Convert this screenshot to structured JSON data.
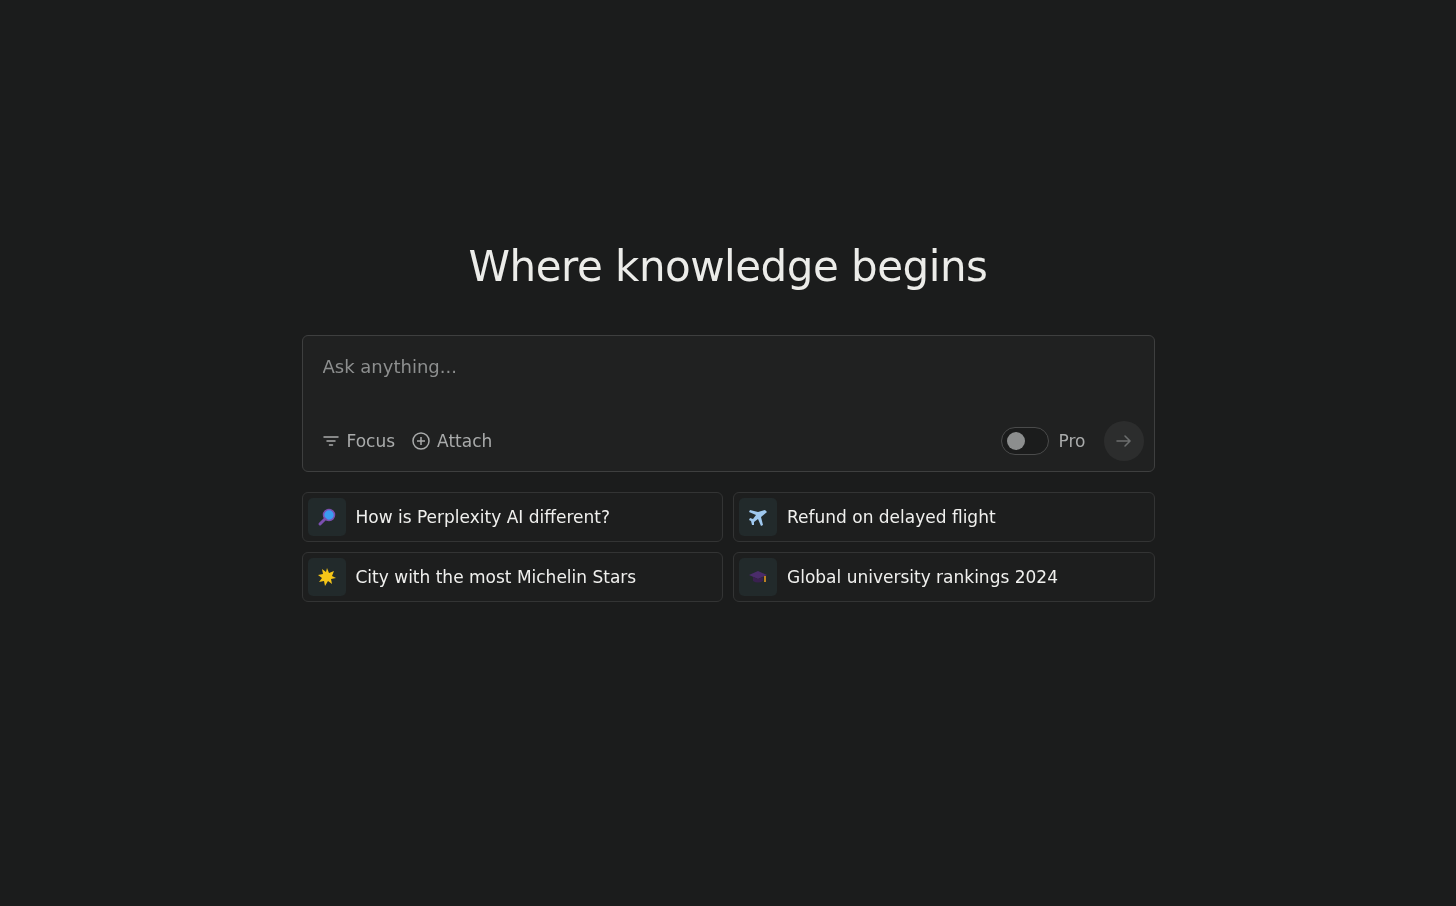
{
  "heading": "Where knowledge begins",
  "search": {
    "placeholder": "Ask anything...",
    "focus_label": "Focus",
    "attach_label": "Attach",
    "pro": {
      "label": "Pro",
      "on": false
    }
  },
  "suggestions": [
    {
      "kind": "magnifier",
      "text": "How is Perplexity AI different?"
    },
    {
      "kind": "airplane",
      "text": "Refund on delayed flight"
    },
    {
      "kind": "star",
      "text": "City with the most Michelin Stars"
    },
    {
      "kind": "graduation-cap",
      "text": "Global university rankings 2024"
    }
  ]
}
